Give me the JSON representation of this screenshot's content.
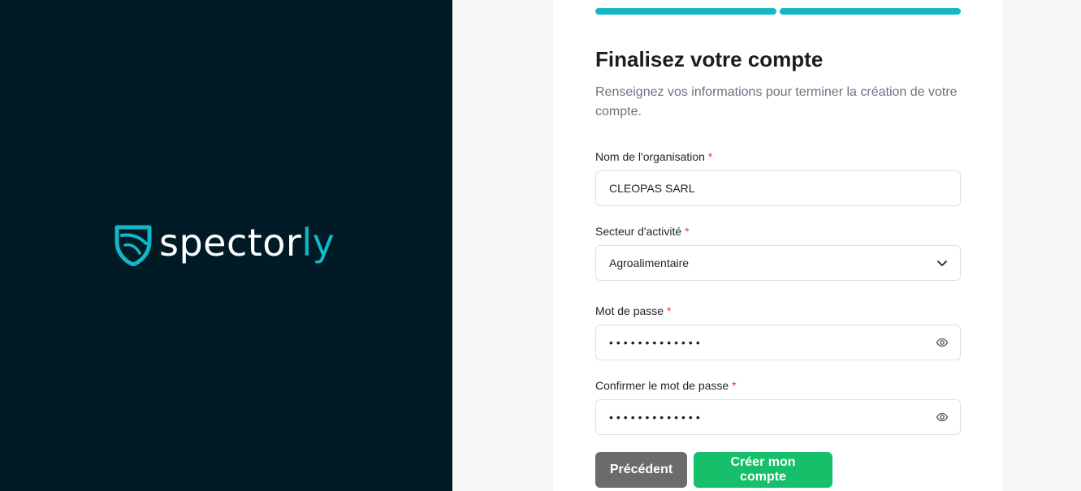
{
  "brand": {
    "name_main": "spector",
    "name_accent": "ly",
    "accent_color": "#12b8c8",
    "bg_color": "#001a26"
  },
  "progress": {
    "steps_total": 2,
    "steps_completed": 2,
    "color": "#14b8c4"
  },
  "form": {
    "title": "Finalisez votre compte",
    "subtitle": "Renseignez vos informations pour terminer la création de votre compte.",
    "required_mark": "*",
    "organisation": {
      "label": "Nom de l'organisation",
      "value": "CLEOPAS SARL"
    },
    "sector": {
      "label": "Secteur d'activité",
      "value": "Agroalimentaire"
    },
    "password": {
      "label": "Mot de passe",
      "masked": "•••••••••••••"
    },
    "confirm_password": {
      "label": "Confirmer le mot de passe",
      "masked": "•••••••••••••"
    }
  },
  "actions": {
    "previous_label": "Précédent",
    "create_label": "Créer mon compte",
    "previous_color": "#6b6b6b",
    "create_color": "#16c06a"
  }
}
